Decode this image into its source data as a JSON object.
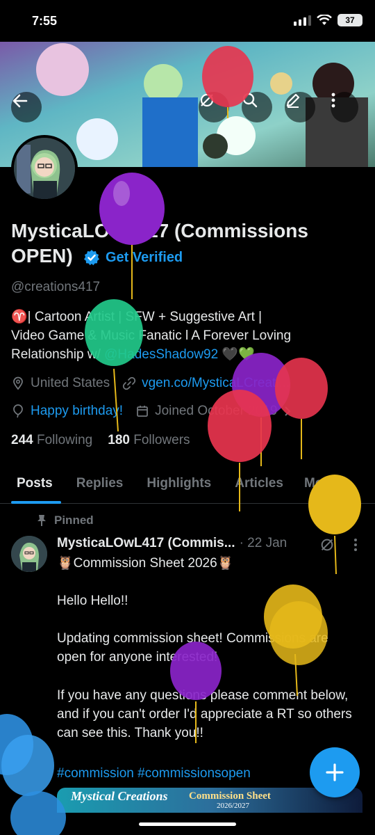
{
  "status_bar": {
    "time": "7:55",
    "battery": "37"
  },
  "colors": {
    "accent": "#1d9bf0",
    "background": "#000000",
    "muted": "#71767b",
    "text": "#e7e9ea"
  },
  "header_icons": [
    "back-arrow-icon",
    "grok-icon",
    "search-icon",
    "edit-icon",
    "more-vertical-icon"
  ],
  "profile": {
    "display_name": "MysticaLOwL417 (Commissions OPEN)",
    "get_verified": "Get Verified",
    "handle": "@creations417",
    "bio_line1": "♈| Cartoon Artist | SFW + Suggestive Art |",
    "bio_line2": "Video Game & Music Fanatic l A Forever Loving",
    "bio_line3_prefix": "Relationship w/ ",
    "bio_mention": "@HadesShadow92",
    "bio_hearts": " 🖤💚",
    "location": "United States",
    "website": "vgen.co/MysticaLCreati...",
    "birthday": "Happy birthday!",
    "joined": "Joined October 2019",
    "following_count": "244",
    "following_label": "Following",
    "followers_count": "180",
    "followers_label": "Followers"
  },
  "tabs": [
    {
      "label": "Posts",
      "active": true
    },
    {
      "label": "Replies",
      "active": false
    },
    {
      "label": "Highlights",
      "active": false
    },
    {
      "label": "Articles",
      "active": false
    },
    {
      "label": "Media",
      "active": false
    }
  ],
  "pinned_post": {
    "pinned_label": "Pinned",
    "author": "MysticaLOwL417 (Commis...",
    "date": "· 22 Jan",
    "title": "🦉Commission Sheet 2026🦉",
    "para1": "Hello Hello!!",
    "para2": "Updating commission sheet! Commissions are open for anyone interested!",
    "para3": "If you have any questions please comment below, and if you can't order I'd appreciate a RT so others can see this. Thank you!!",
    "hashtags": "#commission #commissionsopen",
    "image_logo": "Mystical Creations",
    "image_title": "Commission Sheet",
    "image_year": "2026/2027"
  },
  "fab": {
    "icon": "plus-icon"
  },
  "balloons": [
    {
      "color": "#e8344e",
      "label": "red-balloon-banner"
    },
    {
      "color": "#8a24c9",
      "label": "purple-balloon-top"
    },
    {
      "color": "#22c98a",
      "label": "green-balloon"
    },
    {
      "color": "#8a24c9",
      "label": "purple-balloon-mid"
    },
    {
      "color": "#e8344e",
      "label": "red-balloon-mid"
    },
    {
      "color": "#e8344e",
      "label": "red-balloon-right"
    },
    {
      "color": "#e5b81a",
      "label": "yellow-balloon-right"
    },
    {
      "color": "#e5b81a",
      "label": "yellow-balloon-bottom"
    },
    {
      "color": "#8a24c9",
      "label": "purple-balloon-bottom"
    },
    {
      "color": "#2d8fe0",
      "label": "blue-balloon"
    }
  ]
}
